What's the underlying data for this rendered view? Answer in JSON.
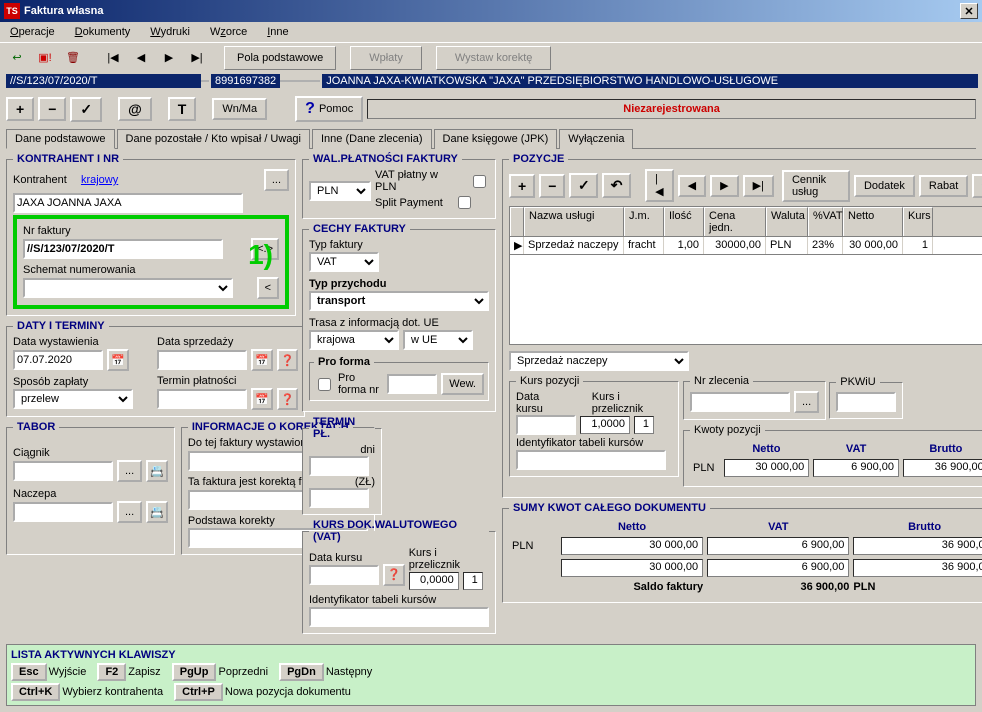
{
  "title": "Faktura własna",
  "menubar": [
    "Operacje",
    "Dokumenty",
    "Wydruki",
    "Wzorce",
    "Inne"
  ],
  "toolbar1": {
    "pola": "Pola podstawowe",
    "wplaty": "Wpłaty",
    "korekta": "Wystaw korektę"
  },
  "infobar": {
    "docnr": "//S/123/07/2020/T",
    "nip": "8991697382",
    "name": "JOANNA JAXA-KWIATKOWSKA \"JAXA\" PRZEDSIĘBIORSTWO HANDLOWO-USŁUGOWE"
  },
  "row1": {
    "wnma": "Wn/Ma",
    "pomoc": "Pomoc",
    "status": "Niezarejestrowana"
  },
  "tabs": [
    "Dane podstawowe",
    "Dane pozostałe / Kto wpisał / Uwagi",
    "Inne (Dane zlecenia)",
    "Dane księgowe (JPK)",
    "Wyłączenia"
  ],
  "kontrahent": {
    "legend": "KONTRAHENT I NR",
    "label": "Kontrahent",
    "krajowy": "krajowy",
    "name": "JAXA JOANNA JAXA",
    "nrfak_label": "Nr faktury",
    "nrfak": "//S/123/07/2020/T",
    "schemat_label": "Schemat numerowania",
    "schemat": "",
    "highlight": "1)"
  },
  "daty": {
    "legend": "DATY I TERMINY",
    "wyst_label": "Data wystawienia",
    "wyst": "07.07.2020",
    "sprz_label": "Data sprzedaży",
    "sprz": "",
    "zapl_label": "Sposób zapłaty",
    "zapl": "przelew",
    "termp_label": "Termin płatności",
    "termp": ""
  },
  "tabor": {
    "legend": "TABOR",
    "ciagnik": "Ciągnik",
    "naczepa": "Naczepa"
  },
  "walplat": {
    "legend": "WAL.PŁATNOŚCI FAKTURY",
    "wal": "PLN",
    "vatpln": "VAT płatny w PLN",
    "split": "Split Payment"
  },
  "cechy": {
    "legend": "CECHY FAKTURY",
    "typ_label": "Typ faktury",
    "typ": "VAT",
    "przych_label": "Typ przychodu",
    "przych": "transport",
    "trasa_label": "Trasa z informacją dot. UE",
    "trasa": "krajowa",
    "wue": "w UE",
    "proforma_legend": "Pro forma",
    "proforma_label": "Pro forma nr",
    "proforma": "",
    "wew": "Wew."
  },
  "korekty": {
    "legend": "INFORMACJE O KOREKTACH",
    "dotej": "Do tej faktury wystawiono korektę nr",
    "tafak": "Ta faktura jest korektą faktury nr",
    "podst": "Podstawa korekty"
  },
  "terminpl": {
    "legend": "TERMIN PŁ.",
    "dni": "dni",
    "zl": "(ZŁ)"
  },
  "kursdok": {
    "legend": "KURS DOK.WALUTOWEGO (VAT)",
    "data": "Data kursu",
    "kip": "Kurs i przelicznik",
    "kurs": "0,0000",
    "przel": "1",
    "ident": "Identyfikator tabeli kursów"
  },
  "pozycje": {
    "legend": "POZYCJE",
    "cennik": "Cennik usług",
    "dodatek": "Dodatek",
    "rabat": "Rabat",
    "cols": [
      "Nazwa usługi",
      "J.m.",
      "Ilość",
      "Cena jedn.",
      "Waluta",
      "%VAT",
      "Netto",
      "Kurs"
    ],
    "row": [
      "Sprzedaż naczepy",
      "fracht",
      "1,00",
      "30000,00",
      "PLN",
      "23%",
      "30 000,00",
      "1"
    ]
  },
  "pozdetail": {
    "sel": "Sprzedaż naczepy",
    "kurspoz": "Kurs pozycji",
    "datakursu": "Data kursu",
    "kip": "Kurs i przelicznik",
    "kurs": "1,0000",
    "przel": "1",
    "ident": "Identyfikator tabeli kursów",
    "nrzlec": "Nr zlecenia",
    "pkwiu": "PKWiU",
    "kwoty": "Kwoty pozycji",
    "netto_h": "Netto",
    "vat_h": "VAT",
    "brutto_h": "Brutto",
    "wal": "PLN",
    "netto": "30 000,00",
    "vat": "6 900,00",
    "brutto": "36 900,00"
  },
  "sumy": {
    "legend": "SUMY KWOT CAŁEGO DOKUMENTU",
    "netto_h": "Netto",
    "vat_h": "VAT",
    "brutto_h": "Brutto",
    "wal": "PLN",
    "netto1": "30 000,00",
    "vat1": "6 900,00",
    "brutto1": "36 900,00",
    "netto2": "30 000,00",
    "vat2": "6 900,00",
    "brutto2": "36 900,00",
    "saldo_l": "Saldo faktury",
    "saldo": "36 900,00",
    "saldo_wal": "PLN"
  },
  "keys": {
    "title": "LISTA AKTYWNYCH KLAWISZY",
    "esc": "Esc",
    "esc_t": "Wyjście",
    "f2": "F2",
    "f2_t": "Zapisz",
    "pgup": "PgUp",
    "pgup_t": "Poprzedni",
    "pgdn": "PgDn",
    "pgdn_t": "Następny",
    "ctrlk": "Ctrl+K",
    "ctrlk_t": "Wybierz kontrahenta",
    "ctrlp": "Ctrl+P",
    "ctrlp_t": "Nowa pozycja dokumentu"
  }
}
